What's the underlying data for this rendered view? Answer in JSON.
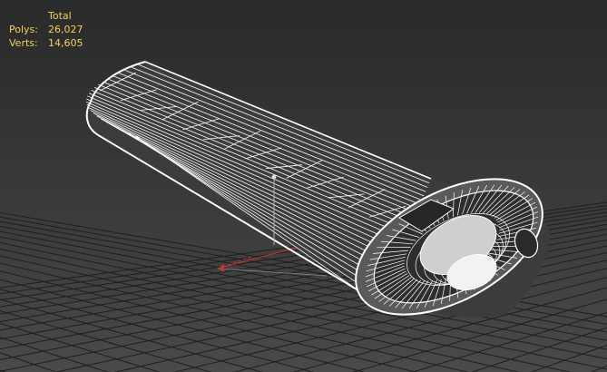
{
  "viewport": {
    "stats": {
      "header": "Total",
      "rows": [
        {
          "label": "Polys:",
          "value": "26,027"
        },
        {
          "label": "Verts:",
          "value": "14,605"
        }
      ]
    }
  },
  "colors": {
    "background_top": "#2a2a2a",
    "background_bottom": "#4a4a4a",
    "grid_line": "#1e1e1e",
    "wireframe": "#ffffff",
    "stats_text": "#f0d25c",
    "axis_x": "#c0392b",
    "axis_z": "#9a9a9a"
  }
}
